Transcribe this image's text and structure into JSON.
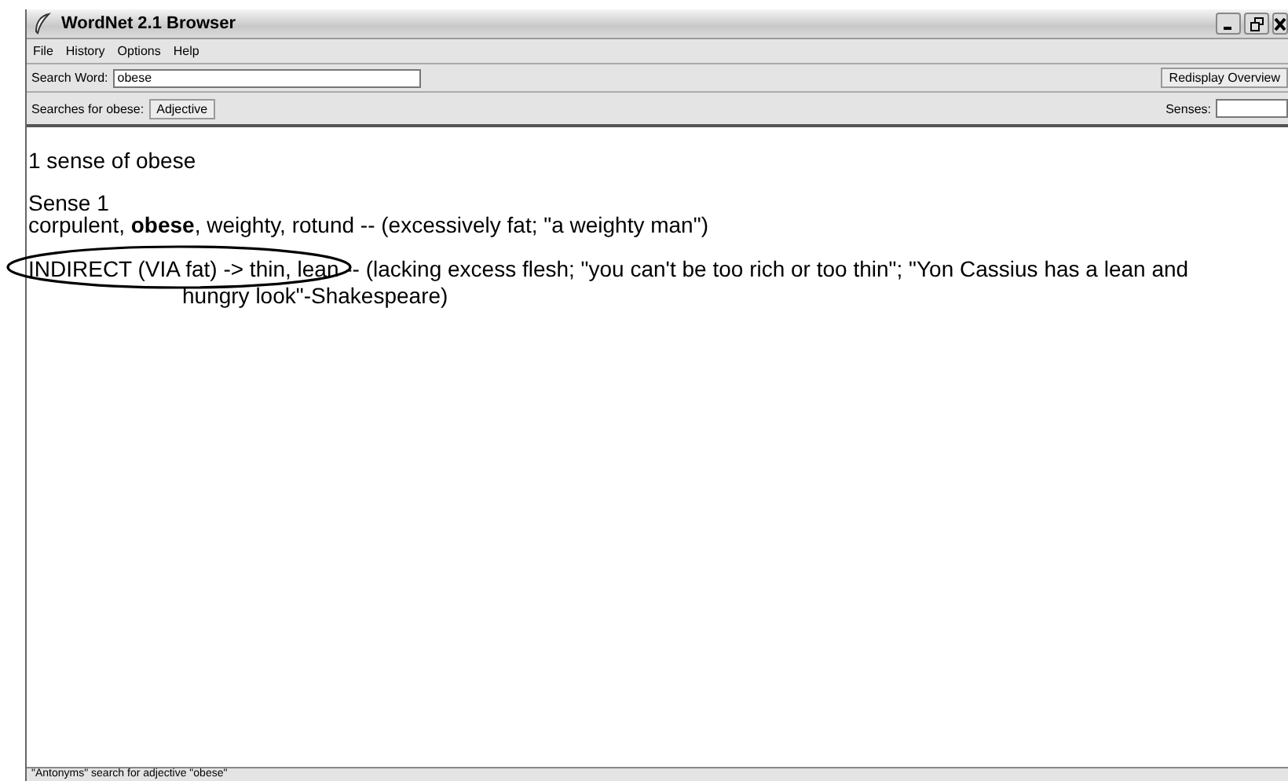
{
  "window": {
    "title": "WordNet 2.1 Browser"
  },
  "menu": [
    "File",
    "History",
    "Options",
    "Help"
  ],
  "search": {
    "label": "Search Word:",
    "value": "obese",
    "button": "Redisplay Overview"
  },
  "searches": {
    "label": "Searches for obese:",
    "buttons": [
      "Adjective"
    ],
    "senses_label": "Senses:"
  },
  "content": {
    "heading": "1 sense of obese",
    "sense": "Sense 1",
    "synonyms": "corpulent, **obese**, weighty, rotund -- (excessively fat; \"a weighty man\")",
    "antonym": "INDIRECT (VIA fat) -> thin, lean -- (lacking excess flesh; \"you can't be too rich or too thin\"; \"Yon Cassius has a lean and hungry look\"-Shakespeare)",
    "circled": true
  },
  "status_bar": "\"Antonyms\" search for adjective \"obese\""
}
